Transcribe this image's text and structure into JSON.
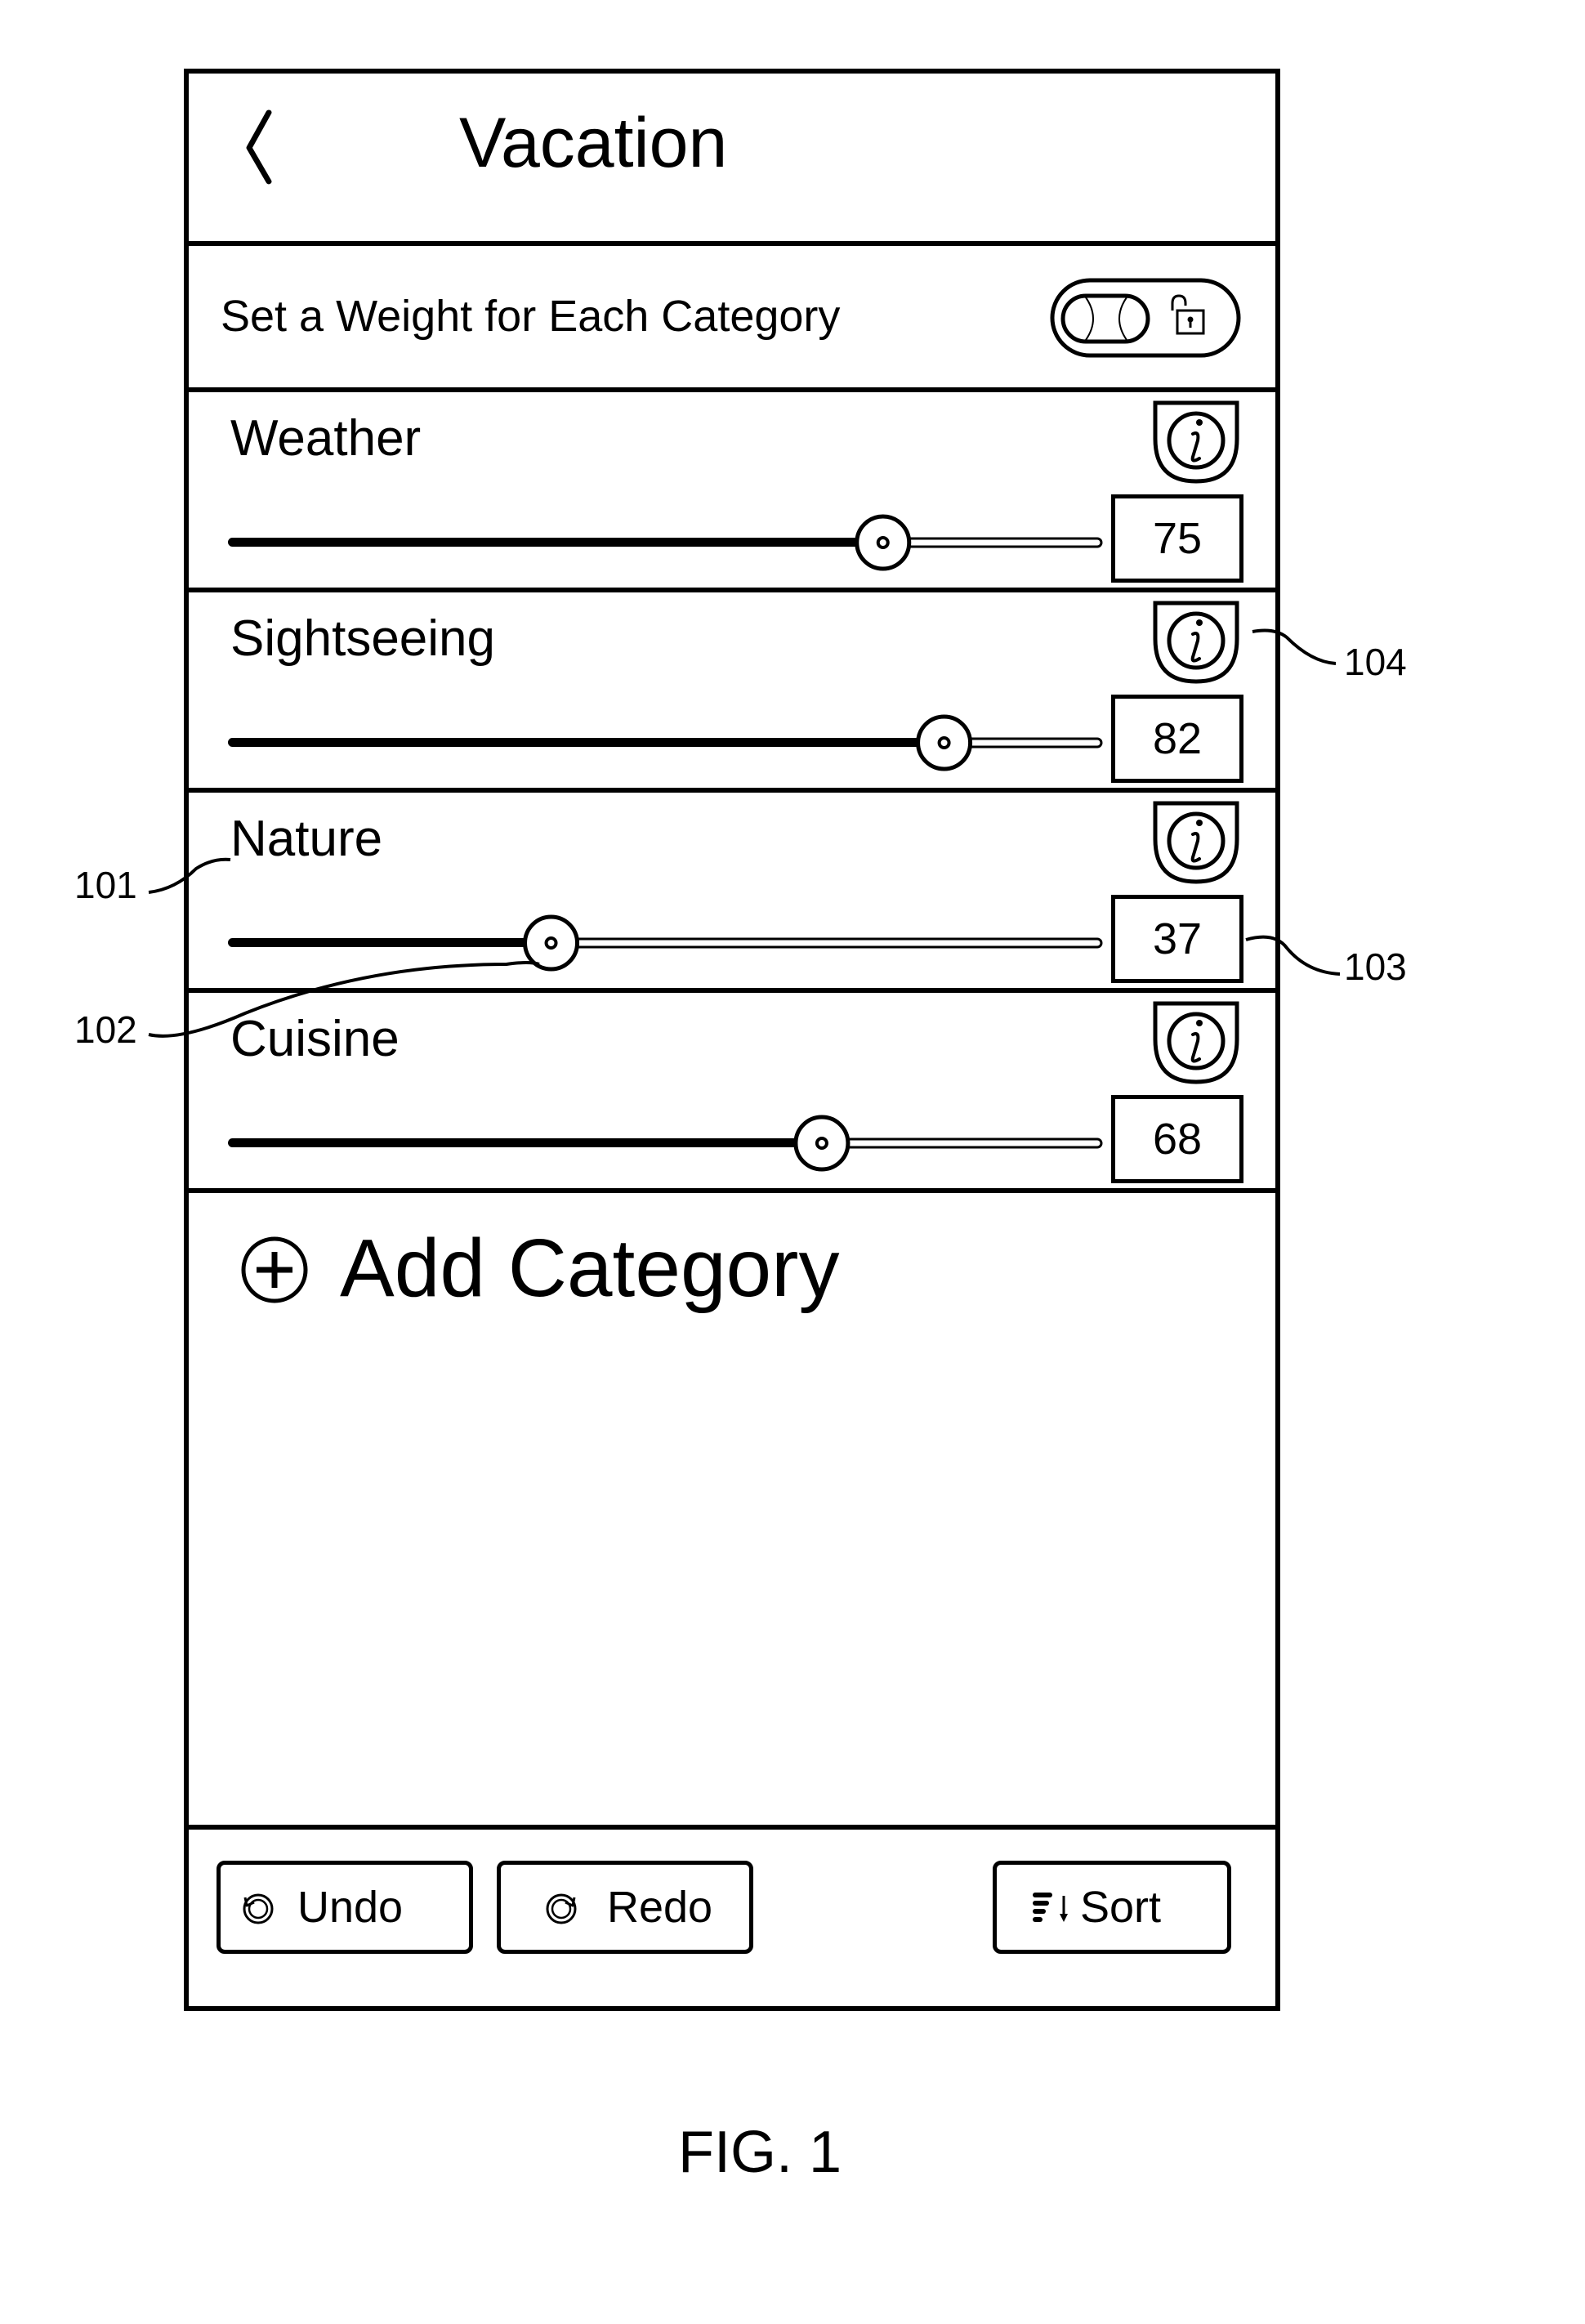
{
  "header": {
    "title": "Vacation",
    "back_icon": "chevron-left-icon"
  },
  "weight_settings": {
    "label": "Set a Weight for Each Category",
    "toggle_icon": "toggle-switch-icon",
    "lock_icon": "unlocked-padlock-icon",
    "lock_state": "unlocked"
  },
  "slider_range": {
    "min": 0,
    "max": 100
  },
  "categories": [
    {
      "label": "Weather",
      "value": 75,
      "info_icon": "info-icon"
    },
    {
      "label": "Sightseeing",
      "value": 82,
      "info_icon": "info-icon"
    },
    {
      "label": "Nature",
      "value": 37,
      "info_icon": "info-icon"
    },
    {
      "label": "Cuisine",
      "value": 68,
      "info_icon": "info-icon"
    }
  ],
  "add_category": {
    "label": "Add Category",
    "icon": "plus-circle-icon"
  },
  "toolbar": {
    "undo_label": "Undo",
    "undo_icon": "undo-icon",
    "redo_label": "Redo",
    "redo_icon": "redo-icon",
    "sort_label": "Sort",
    "sort_icon": "sort-descending-icon"
  },
  "callouts": {
    "category_label": "101",
    "slider": "102",
    "value_box": "103",
    "info_button": "104"
  },
  "figure_caption": "FIG. 1"
}
